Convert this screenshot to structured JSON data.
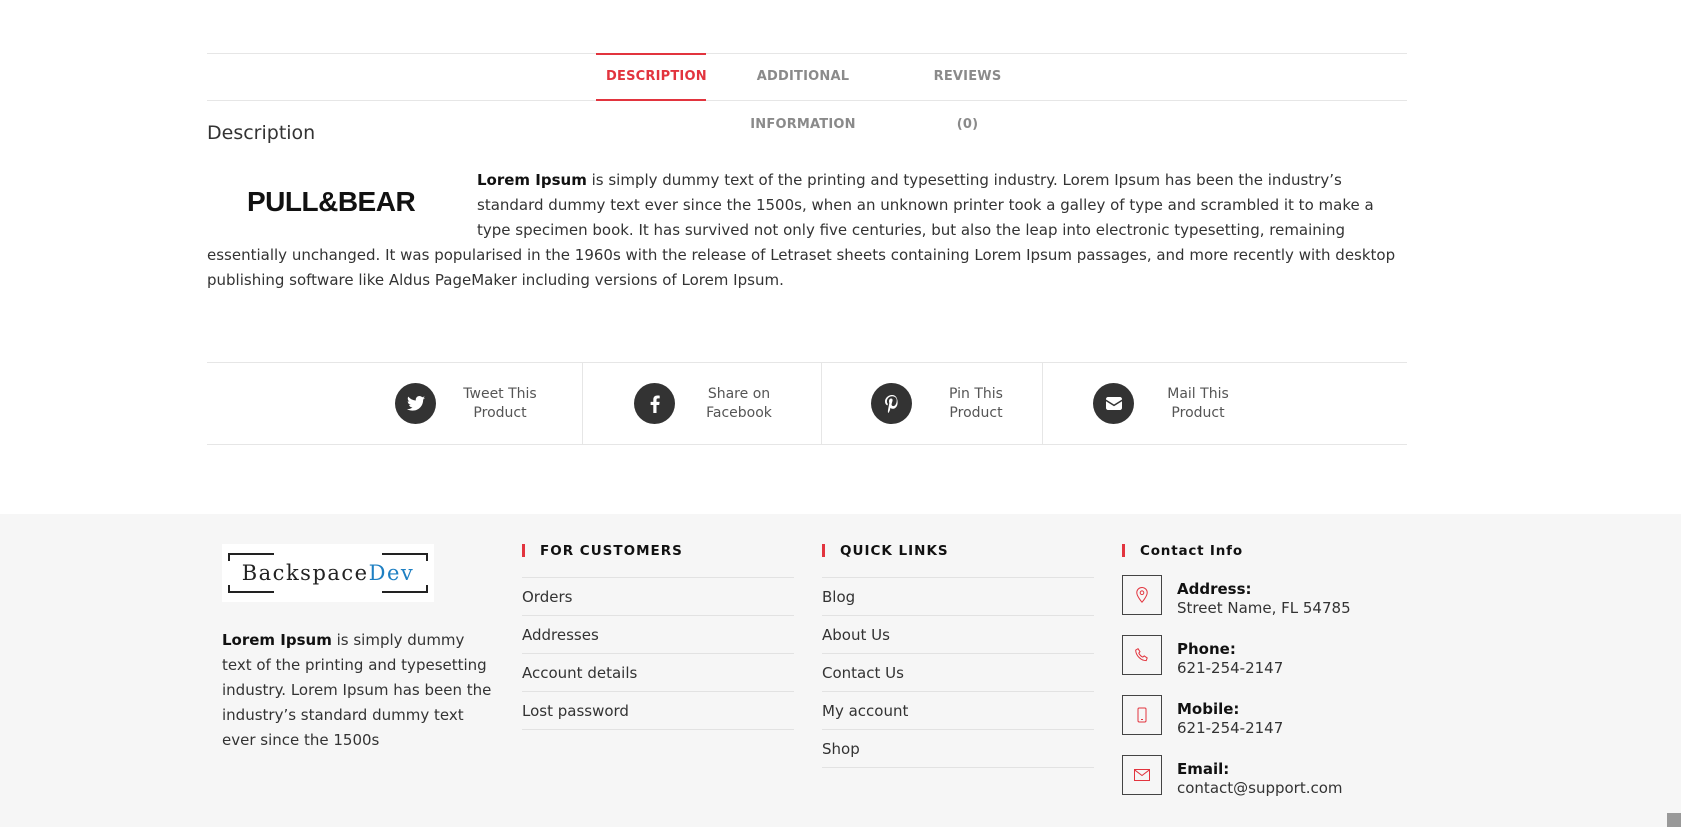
{
  "tabs": [
    {
      "label": "DESCRIPTION",
      "active": true
    },
    {
      "label": "ADDITIONAL INFORMATION",
      "active": false
    },
    {
      "label": "REVIEWS (0)",
      "active": false
    }
  ],
  "description": {
    "heading": "Description",
    "brand_logo_text": "PULL&BEAR",
    "lead_bold": "Lorem Ipsum",
    "body": " is simply dummy text of the printing and typesetting industry. Lorem Ipsum has been the industry’s standard dummy text ever since the 1500s, when an unknown printer took a galley of type and scrambled it to make a type specimen book. It has survived not only five centuries, but also the leap into electronic typesetting, remaining essentially unchanged. It was popularised in the 1960s with the release of Letraset sheets containing Lorem Ipsum passages, and more recently with desktop publishing software like Aldus PageMaker including versions of Lorem Ipsum."
  },
  "share": [
    {
      "icon": "twitter-icon",
      "line1": "Tweet This",
      "line2": "Product"
    },
    {
      "icon": "facebook-icon",
      "line1": "Share on",
      "line2": "Facebook"
    },
    {
      "icon": "pinterest-icon",
      "line1": "Pin This",
      "line2": "Product"
    },
    {
      "icon": "mail-icon",
      "line1": "Mail This",
      "line2": "Product"
    }
  ],
  "footer": {
    "logo": {
      "part1": "Backspace",
      "part2": "Dev",
      "accent_color": "#1e7fc2"
    },
    "about_bold": "Lorem Ipsum",
    "about_text": " is simply dummy text of the printing and typesetting industry. Lorem Ipsum has been the industry’s standard dummy text ever since the 1500s",
    "customers": {
      "title": "FOR CUSTOMERS",
      "links": [
        "Orders",
        "Addresses",
        "Account details",
        "Lost password"
      ]
    },
    "quick_links": {
      "title": "QUICK LINKS",
      "links": [
        "Blog",
        "About Us",
        "Contact Us",
        "My account",
        "Shop"
      ]
    },
    "contact": {
      "title": "Contact Info",
      "items": [
        {
          "icon": "location-pin-icon",
          "label": "Address:",
          "value": "Street Name, FL 54785"
        },
        {
          "icon": "phone-icon",
          "label": "Phone:",
          "value": "621-254-2147"
        },
        {
          "icon": "mobile-icon",
          "label": "Mobile:",
          "value": "621-254-2147"
        },
        {
          "icon": "envelope-icon",
          "label": "Email:",
          "value": "contact@support.com"
        }
      ]
    }
  },
  "colors": {
    "accent": "#e2343e",
    "footer_bg": "#f6f6f6",
    "icon_bg": "#333333"
  }
}
